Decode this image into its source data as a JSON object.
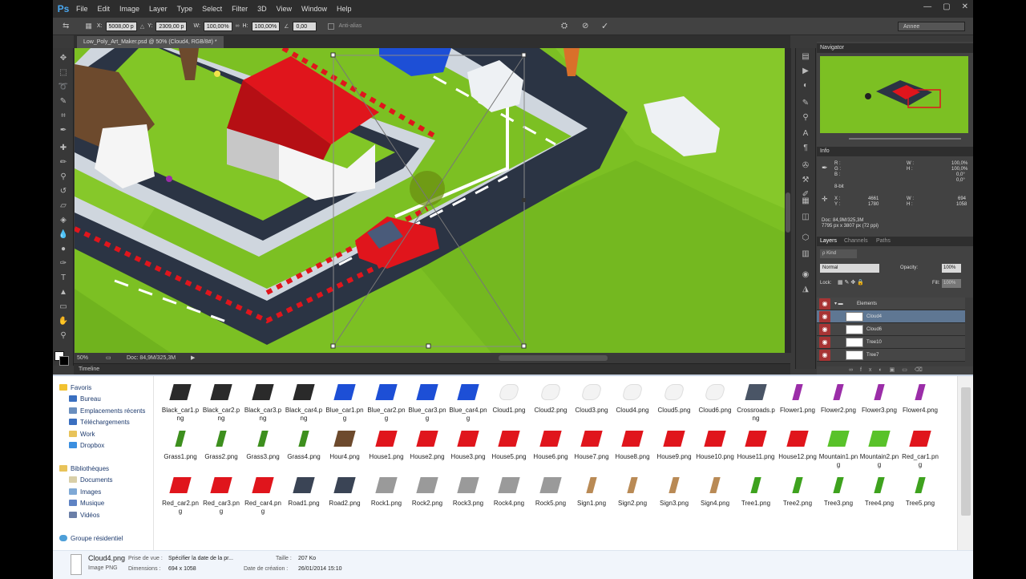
{
  "app": {
    "logo": "Ps",
    "menu": [
      "File",
      "Edit",
      "Image",
      "Layer",
      "Type",
      "Select",
      "Filter",
      "3D",
      "View",
      "Window",
      "Help"
    ],
    "window_buttons": [
      "—",
      "▢",
      "✕"
    ]
  },
  "options": {
    "x_label": "X:",
    "x_value": "5008,00 p",
    "y_label": "Y:",
    "y_value": "2309,00 p",
    "w_label": "W:",
    "w_value": "100,00%",
    "h_label": "H:",
    "h_value": "100,00%",
    "angle_value": "0,00",
    "antialias": "Anti-alias",
    "workspace": "Annee"
  },
  "document": {
    "tab": "Low_Poly_Art_Maker.psd @ 50% (Cloud4, RGB/8#) *",
    "zoom": "50%",
    "doc_size": "Doc: 84,9M/325,3M",
    "timeline": "Timeline"
  },
  "navigator": {
    "title": "Navigator"
  },
  "info": {
    "title": "Info",
    "r": "R :",
    "g": "G :",
    "b": "B :",
    "bit": "8-bit",
    "w": "W :",
    "wv": "100,0%",
    "h": "H :",
    "hv": "100,0%",
    "a1": "0,0°",
    "a2": "0,0°",
    "x": "X :",
    "xv": "4661",
    "y": "Y :",
    "yv": "1780",
    "ww": "W :",
    "wwv": "694",
    "hh": "H :",
    "hhv": "1058",
    "doc": "Doc: 84,9M/325,3M",
    "px": "7795 px x 3807 px (72 ppi)"
  },
  "layers": {
    "tabs": [
      "Layers",
      "Channels",
      "Paths"
    ],
    "kind": "ρ Kind",
    "blend": "Normal",
    "opacity_label": "Opacity:",
    "opacity": "100%",
    "lock_label": "Lock:",
    "fill_label": "Fill:",
    "fill": "100%",
    "group": "Elements",
    "items": [
      "Cloud4",
      "Cloud6",
      "Tree10",
      "Tree7"
    ]
  },
  "explorer": {
    "nav": {
      "favoris": "Favoris",
      "bureau": "Bureau",
      "emplacements": "Emplacements récents",
      "telechargements": "Téléchargements",
      "work": "Work",
      "dropbox": "Dropbox",
      "bibliotheques": "Bibliothèques",
      "documents": "Documents",
      "images": "Images",
      "musique": "Musique",
      "videos": "Vidéos",
      "groupe": "Groupe résidentiel"
    },
    "files": [
      "Black_car1.png",
      "Black_car2.png",
      "Black_car3.png",
      "Black_car4.png",
      "Blue_car1.png",
      "Blue_car2.png",
      "Blue_car3.png",
      "Blue_car4.png",
      "Cloud1.png",
      "Cloud2.png",
      "Cloud3.png",
      "Cloud4.png",
      "Cloud5.png",
      "Cloud6.png",
      "Crossroads.png",
      "Flower1.png",
      "Flower2.png",
      "Flower3.png",
      "Flower4.png",
      "Grass1.png",
      "Grass2.png",
      "Grass3.png",
      "Grass4.png",
      "Hour4.png",
      "House1.png",
      "House2.png",
      "House3.png",
      "House5.png",
      "House6.png",
      "House7.png",
      "House8.png",
      "House9.png",
      "House10.png",
      "House11.png",
      "House12.png",
      "Mountain1.png",
      "Mountain2.png",
      "Red_car1.png",
      "Red_car2.png",
      "Red_car3.png",
      "Red_car4.png",
      "Road1.png",
      "Road2.png",
      "Rock1.png",
      "Rock2.png",
      "Rock3.png",
      "Rock4.png",
      "Rock5.png",
      "Sign1.png",
      "Sign2.png",
      "Sign3.png",
      "Sign4.png",
      "Tree1.png",
      "Tree2.png",
      "Tree3.png",
      "Tree4.png",
      "Tree5.png"
    ],
    "details": {
      "filename": "Cloud4.png",
      "type": "Image PNG",
      "prise_label": "Prise de vue :",
      "prise_value": "Spécifier la date de la pr...",
      "dim_label": "Dimensions :",
      "dim_value": "694 x 1058",
      "taille_label": "Taille :",
      "taille_value": "207 Ko",
      "creation_label": "Date de création :",
      "creation_value": "26/01/2014 15:10"
    }
  },
  "colors": {
    "grass": "#7cc023",
    "road": "#2b3444",
    "house_red": "#e0151c",
    "selection_blue": "#5f7793"
  }
}
